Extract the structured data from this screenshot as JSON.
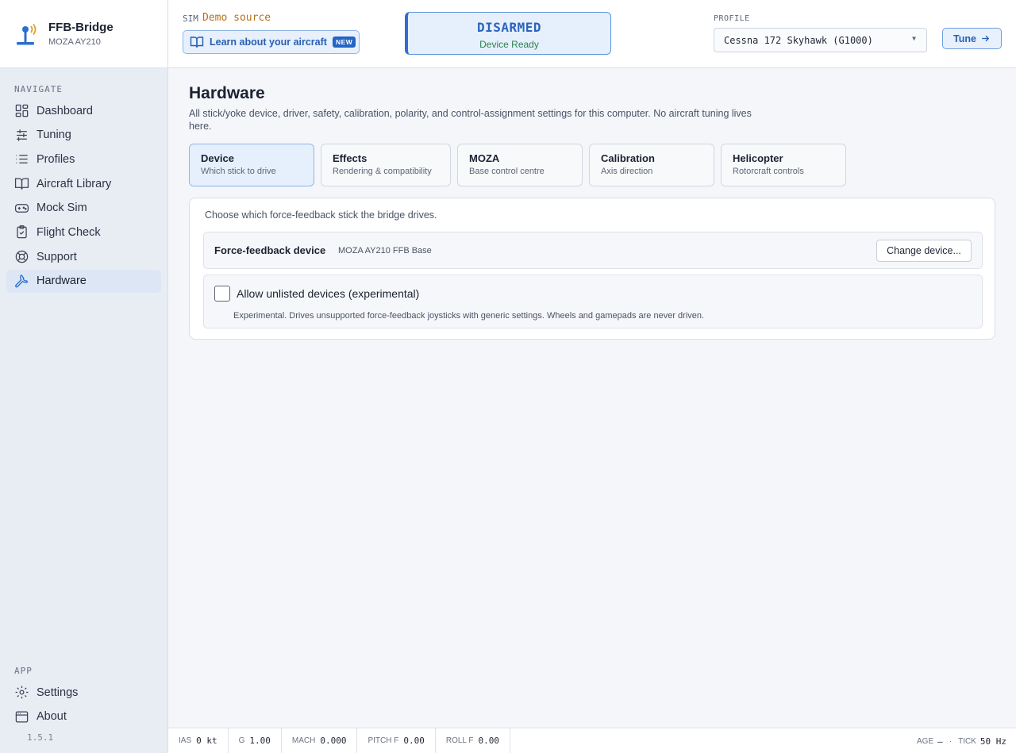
{
  "brand": {
    "name": "FFB-Bridge",
    "device": "MOZA AY210"
  },
  "nav": {
    "heading": "NAVIGATE",
    "items": [
      {
        "label": "Dashboard",
        "icon": "dashboard-icon"
      },
      {
        "label": "Tuning",
        "icon": "sliders-icon"
      },
      {
        "label": "Profiles",
        "icon": "list-icon"
      },
      {
        "label": "Aircraft Library",
        "icon": "book-icon"
      },
      {
        "label": "Mock Sim",
        "icon": "gamepad-icon"
      },
      {
        "label": "Flight Check",
        "icon": "clipboard-check-icon"
      },
      {
        "label": "Support",
        "icon": "lifebuoy-icon"
      },
      {
        "label": "Hardware",
        "icon": "wrench-icon",
        "active": true
      }
    ]
  },
  "app_nav": {
    "heading": "APP",
    "items": [
      {
        "label": "Settings",
        "icon": "gear-icon"
      },
      {
        "label": "About",
        "icon": "window-icon"
      }
    ],
    "version": "1.5.1"
  },
  "topbar": {
    "sim_label": "SIM",
    "sim_value": "Demo source",
    "learn_label": "Learn about your aircraft",
    "learn_badge": "NEW",
    "arm_title": "DISARMED",
    "arm_status": "Device Ready",
    "profile_label": "PROFILE",
    "profile_value": "Cessna 172 Skyhawk (G1000)",
    "tune_label": "Tune"
  },
  "page": {
    "title": "Hardware",
    "description": "All stick/yoke device, driver, safety, calibration, polarity, and control-assignment settings for this computer. No aircraft tuning lives here."
  },
  "tabs": [
    {
      "label": "Device",
      "sub": "Which stick to drive",
      "active": true
    },
    {
      "label": "Effects",
      "sub": "Rendering & compatibility"
    },
    {
      "label": "MOZA",
      "sub": "Base control centre"
    },
    {
      "label": "Calibration",
      "sub": "Axis direction"
    },
    {
      "label": "Helicopter",
      "sub": "Rotorcraft controls"
    }
  ],
  "device_card": {
    "intro": "Choose which force-feedback stick the bridge drives.",
    "device_label": "Force-feedback device",
    "device_value": "MOZA AY210 FFB Base",
    "change_label": "Change device...",
    "unlisted_label": "Allow unlisted devices (experimental)",
    "unlisted_checked": false,
    "unlisted_desc": "Experimental. Drives unsupported force-feedback joysticks with generic settings. Wheels and gamepads are never driven."
  },
  "status": {
    "ias_label": "IAS",
    "ias_value": "0 kt",
    "g_label": "G",
    "g_value": "1.00",
    "mach_label": "MACH",
    "mach_value": "0.000",
    "pitch_label": "PITCH F",
    "pitch_value": "0.00",
    "roll_label": "ROLL F",
    "roll_value": "0.00",
    "age_label": "AGE",
    "age_value": "—",
    "tick_label": "TICK",
    "tick_value": "50 Hz"
  },
  "colors": {
    "accent": "#2d6fce",
    "sim_source": "#b1731c",
    "ready": "#2d7f4c"
  }
}
